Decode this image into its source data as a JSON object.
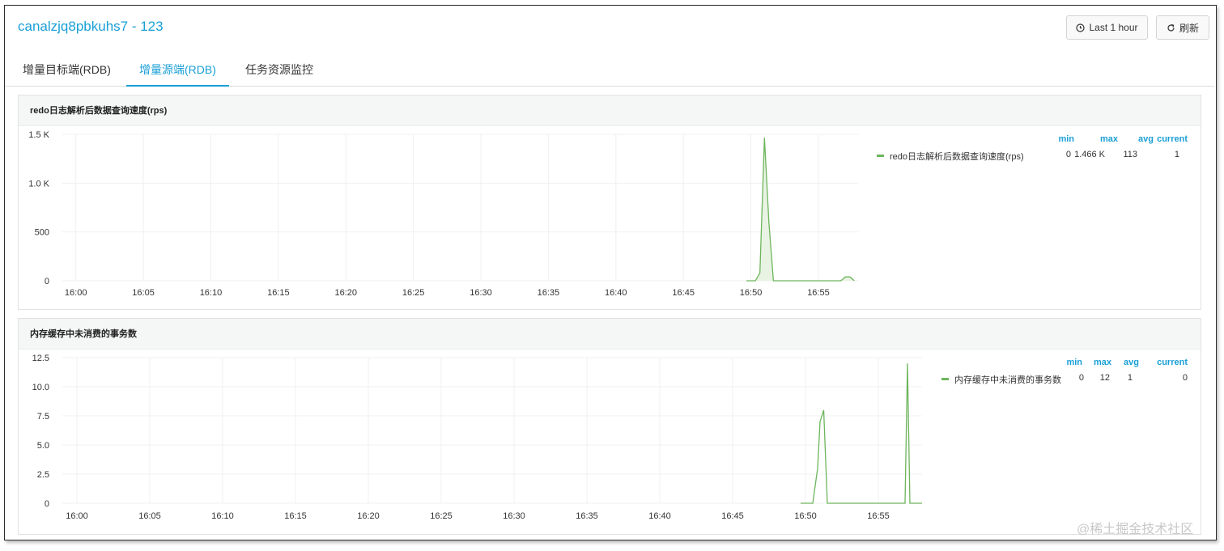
{
  "header": {
    "title": "canalzjq8pbkuhs7 - 123",
    "time_range_label": "Last 1 hour",
    "refresh_label": "刷新"
  },
  "tabs": [
    {
      "label": "增量目标端(RDB)",
      "active": false
    },
    {
      "label": "增量源端(RDB)",
      "active": true
    },
    {
      "label": "任务资源监控",
      "active": false
    }
  ],
  "legend_headers": {
    "min": "min",
    "max": "max",
    "avg": "avg",
    "current": "current"
  },
  "colors": {
    "accent": "#1a9fd6",
    "series": "#6db55c",
    "series_fill": "#e9f3e4"
  },
  "icons": {
    "range": "clock-icon",
    "refresh": "refresh-icon"
  },
  "watermark": "@稀土掘金技术社区",
  "chart_data": [
    {
      "type": "area",
      "title": "redo日志解析后数据查询速度(rps)",
      "x_ticks": [
        "16:00",
        "16:05",
        "16:10",
        "16:15",
        "16:20",
        "16:25",
        "16:30",
        "16:35",
        "16:40",
        "16:45",
        "16:50",
        "16:55"
      ],
      "y_ticks": [
        "0",
        "500",
        "1.0 K",
        "1.5 K"
      ],
      "ylim": [
        0,
        1500
      ],
      "xlim": [
        "15:59",
        "16:58"
      ],
      "series": [
        {
          "name": "redo日志解析后数据查询速度(rps)",
          "x": [
            "16:49:40",
            "16:50:20",
            "16:50:40",
            "16:51:00",
            "16:51:20",
            "16:51:40",
            "16:52:00",
            "16:53:00",
            "16:55:00",
            "16:56:40",
            "16:57:00",
            "16:57:20",
            "16:57:40"
          ],
          "values": [
            0,
            0,
            80,
            1466,
            600,
            0,
            0,
            0,
            0,
            0,
            40,
            40,
            0
          ],
          "min": "0",
          "max": "1.466 K",
          "avg": "113",
          "current": "1"
        }
      ],
      "grid": true,
      "legend": "right"
    },
    {
      "type": "line",
      "title": "内存缓存中未消费的事务数",
      "x_ticks": [
        "16:00",
        "16:05",
        "16:10",
        "16:15",
        "16:20",
        "16:25",
        "16:30",
        "16:35",
        "16:40",
        "16:45",
        "16:50",
        "16:55"
      ],
      "y_ticks": [
        "0",
        "2.5",
        "5.0",
        "7.5",
        "10.0",
        "12.5"
      ],
      "ylim": [
        0,
        12.5
      ],
      "xlim": [
        "15:59",
        "16:58"
      ],
      "series": [
        {
          "name": "内存缓存中未消费的事务数",
          "x": [
            "16:49:40",
            "16:50:30",
            "16:50:50",
            "16:51:00",
            "16:51:15",
            "16:51:30",
            "16:54:00",
            "16:56:50",
            "16:57:00",
            "16:57:10",
            "16:57:20",
            "16:58:00"
          ],
          "values": [
            0,
            0,
            3,
            7,
            8,
            0,
            0,
            0,
            12,
            0,
            0,
            0
          ],
          "min": "0",
          "max": "12",
          "avg": "1",
          "current": "0"
        }
      ],
      "grid": true,
      "legend": "right"
    }
  ]
}
